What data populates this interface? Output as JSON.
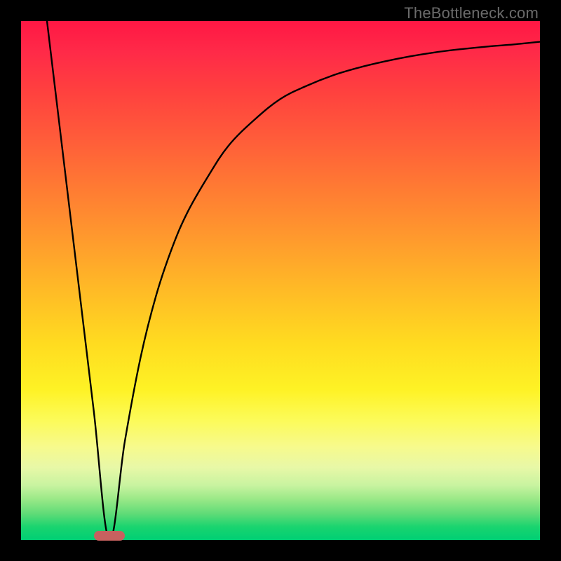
{
  "watermark": "TheBottleneck.com",
  "colors": {
    "frame": "#000000",
    "gradient_top": "#ff1744",
    "gradient_mid1": "#ff9a2d",
    "gradient_mid2": "#ffdb20",
    "gradient_bottom": "#00cf74",
    "curve": "#000000",
    "marker": "#c7615f"
  },
  "chart_data": {
    "type": "line",
    "title": "",
    "xlabel": "",
    "ylabel": "",
    "xlim": [
      0,
      100
    ],
    "ylim": [
      0,
      100
    ],
    "grid": false,
    "legend": false,
    "annotations": [
      "TheBottleneck.com"
    ],
    "marker": {
      "x_center": 17,
      "width": 6,
      "y": 0
    },
    "series": [
      {
        "name": "bottleneck-curve",
        "x": [
          5,
          8,
          11,
          14,
          17,
          20,
          23,
          26,
          29,
          32,
          36,
          40,
          45,
          50,
          55,
          60,
          65,
          70,
          75,
          80,
          85,
          90,
          95,
          100
        ],
        "y": [
          100,
          75,
          50,
          25,
          0,
          19,
          35,
          47,
          56,
          63,
          70,
          76,
          81,
          85,
          87.5,
          89.5,
          91,
          92.2,
          93.2,
          94,
          94.6,
          95.1,
          95.5,
          96
        ]
      }
    ]
  }
}
